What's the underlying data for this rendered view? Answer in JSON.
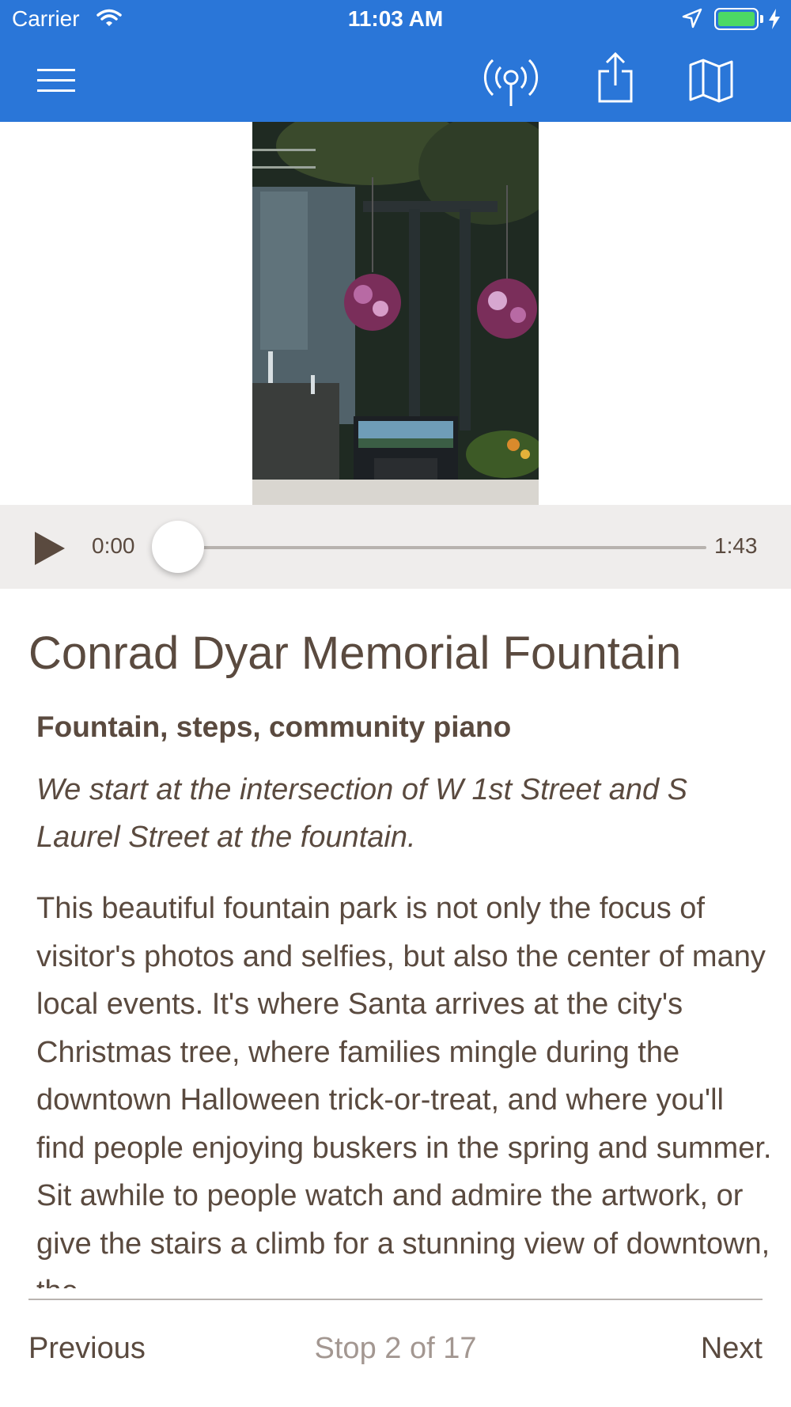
{
  "status_bar": {
    "carrier": "Carrier",
    "time": "11:03 AM"
  },
  "nav": {
    "icons": [
      "menu-icon",
      "broadcast-icon",
      "share-icon",
      "map-icon"
    ],
    "bar_color": "#2a76d8"
  },
  "player": {
    "current_time": "0:00",
    "total_time": "1:43",
    "progress": 0
  },
  "stop": {
    "title": "Conrad Dyar Memorial Fountain",
    "subtitle": "Fountain, steps, community piano",
    "intro": "We start at the intersection of W 1st Street and S Laurel Street at the fountain.",
    "body": "This beautiful fountain park is not only the focus of visitor's photos and selfies, but also the center of many local events. It's where Santa arrives at the city's Christmas tree, where families mingle during the downtown Halloween trick-or-treat, and where you'll find people enjoying buskers in the spring and summer. Sit awhile to people watch and admire the artwork, or give the stairs a climb for a stunning view of downtown, the"
  },
  "footer": {
    "previous_label": "Previous",
    "stop_counter": "Stop 2 of 17",
    "next_label": "Next"
  },
  "colors": {
    "accent": "#2a76d8",
    "text": "#5a4a3f",
    "muted": "#a39791",
    "player_bg": "#efedec"
  }
}
